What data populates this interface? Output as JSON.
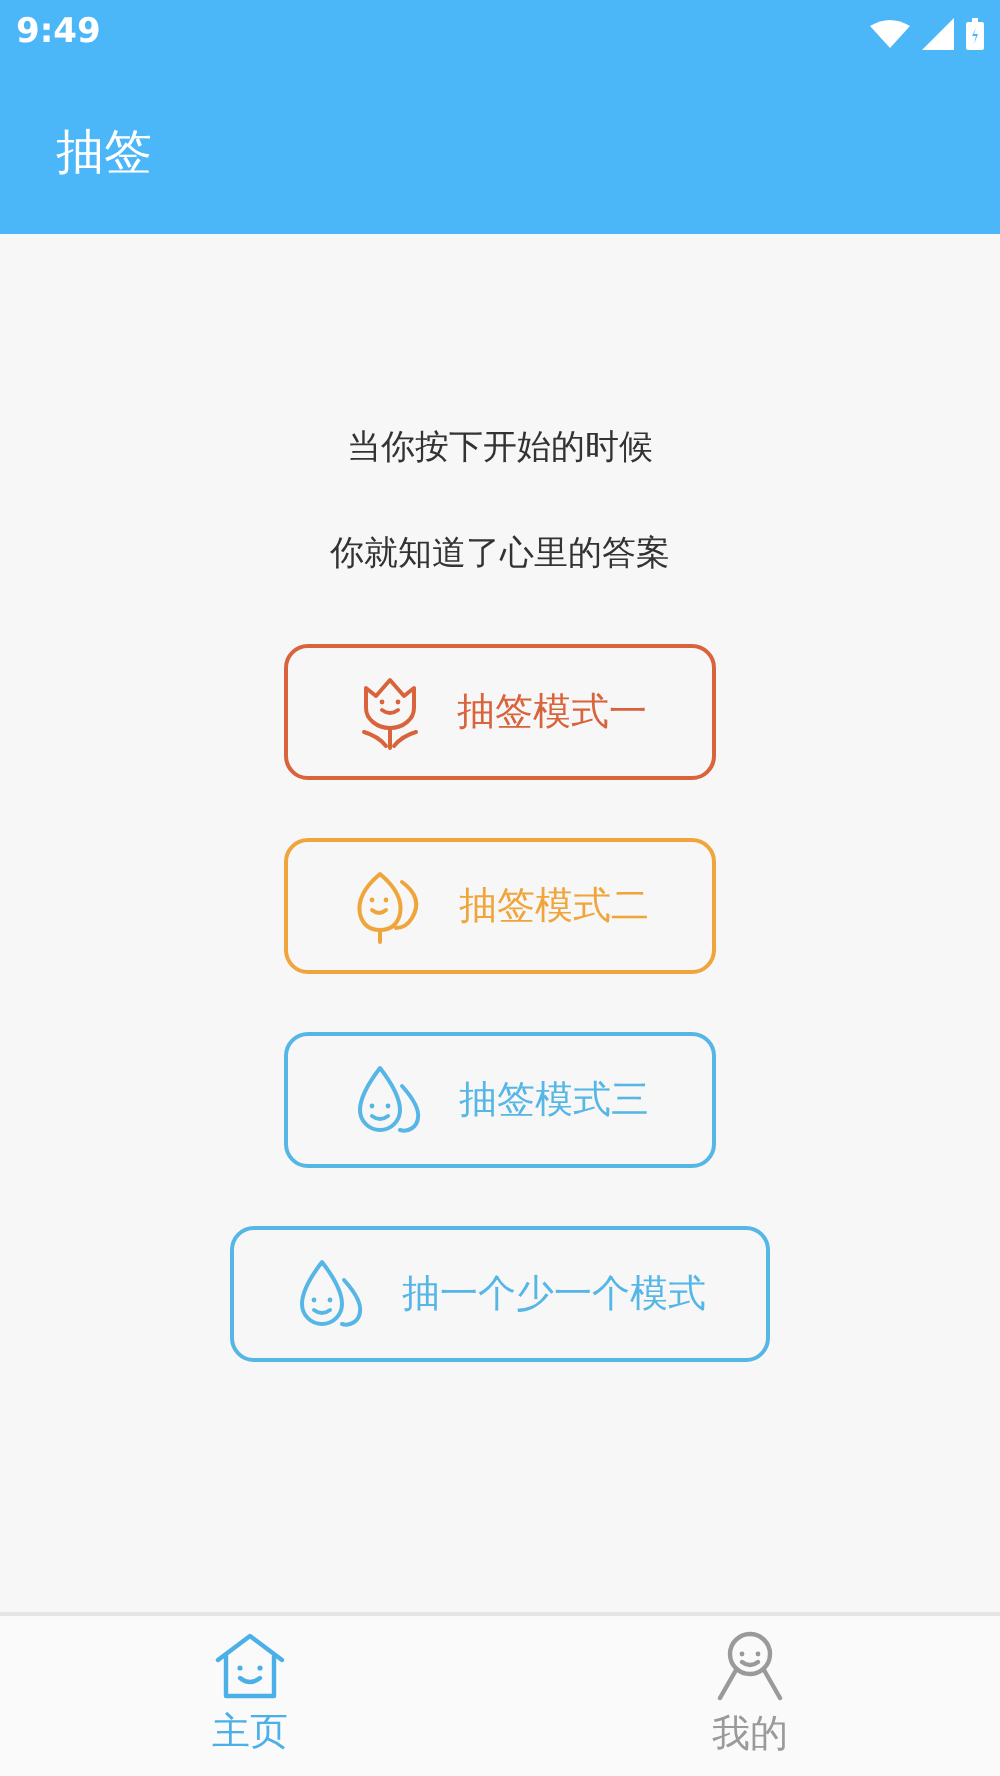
{
  "status_bar": {
    "time": "9:49"
  },
  "header": {
    "title": "抽签"
  },
  "intro": [
    "当你按下开始的时候",
    "你就知道了心里的答案"
  ],
  "modes": [
    {
      "label": "抽签模式一",
      "kind": "flower",
      "color": "#d9643c"
    },
    {
      "label": "抽签模式二",
      "kind": "leaf",
      "color": "#f0a53c"
    },
    {
      "label": "抽签模式三",
      "kind": "drop",
      "color": "#56b6e6"
    },
    {
      "label": "抽一个少一个模式",
      "kind": "drop",
      "color": "#56b6e6"
    }
  ],
  "tabs": [
    {
      "label": "主页",
      "kind": "home",
      "selected": true
    },
    {
      "label": "我的",
      "kind": "person",
      "selected": false
    }
  ]
}
